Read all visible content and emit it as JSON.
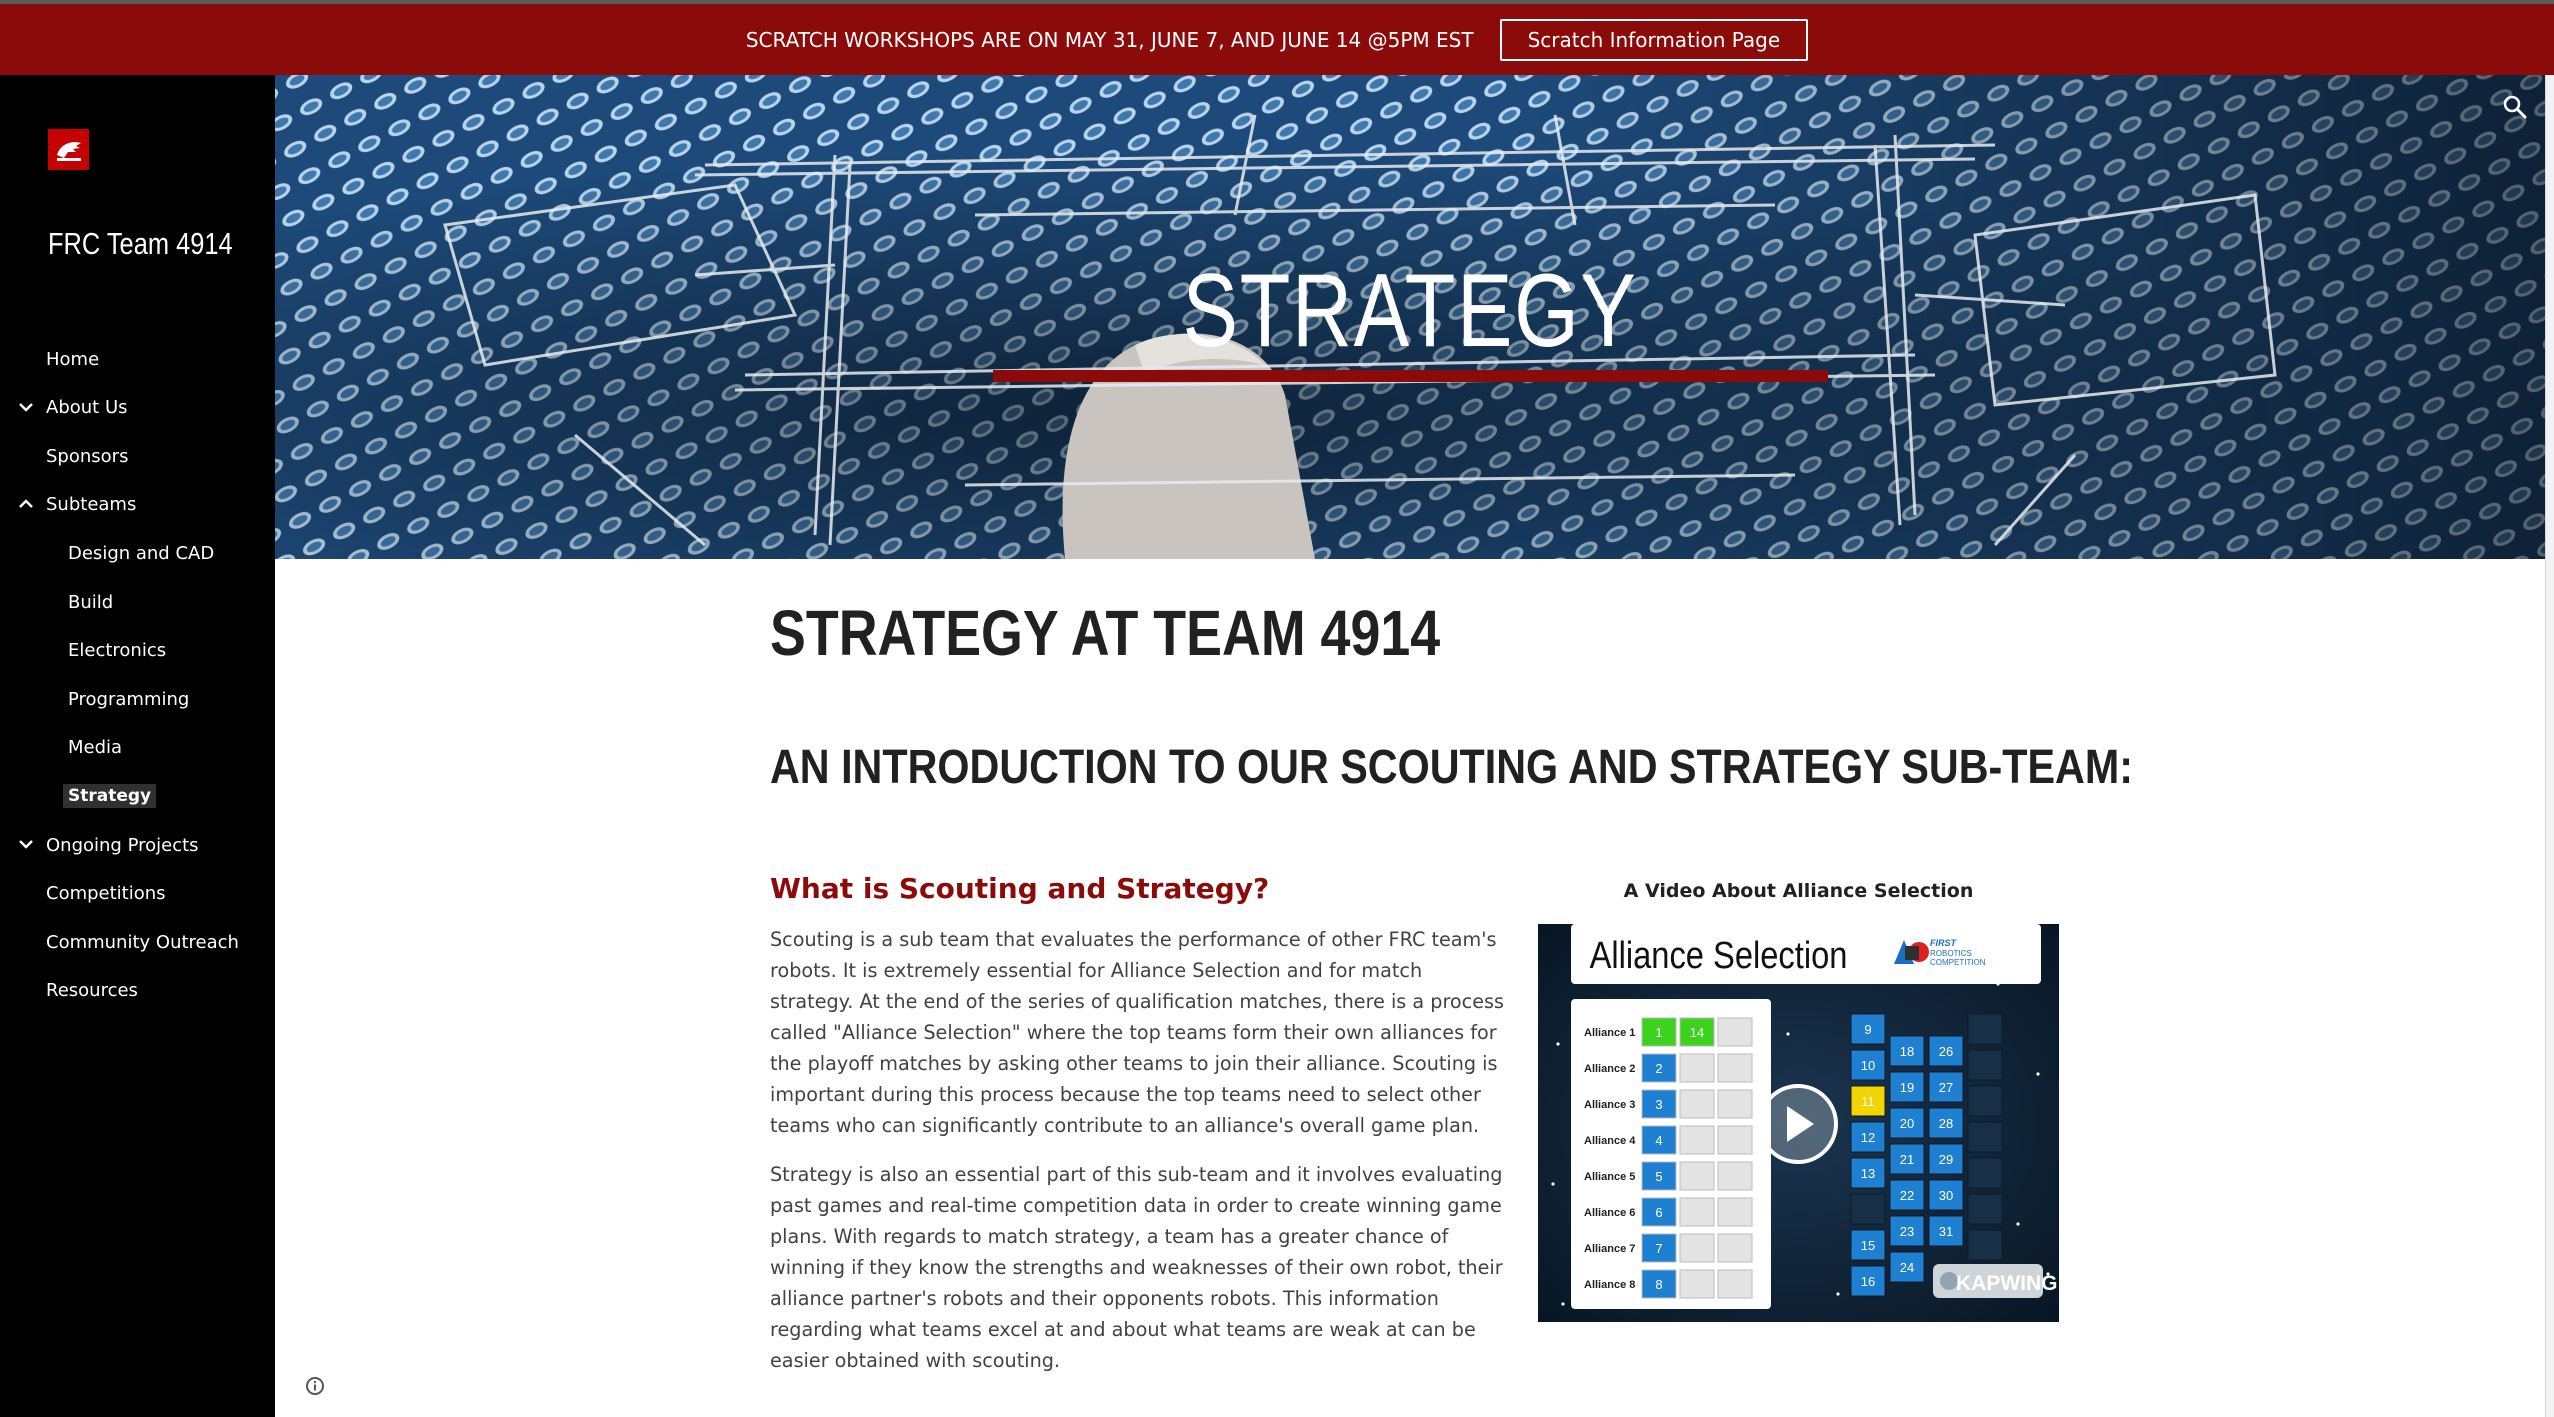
{
  "banner": {
    "text": "SCRATCH WORKSHOPS ARE ON MAY 31, JUNE 7, AND JUNE 14 @5PM EST",
    "button_label": "Scratch Information Page"
  },
  "site": {
    "title": "FRC Team 4914"
  },
  "nav": {
    "items": [
      {
        "label": "Home",
        "chevron": "none",
        "level": 0
      },
      {
        "label": "About Us",
        "chevron": "down",
        "level": 0
      },
      {
        "label": "Sponsors",
        "chevron": "none",
        "level": 0
      },
      {
        "label": "Subteams",
        "chevron": "up",
        "level": 0
      },
      {
        "label": "Design and CAD",
        "chevron": "none",
        "level": 1
      },
      {
        "label": "Build",
        "chevron": "none",
        "level": 1
      },
      {
        "label": "Electronics",
        "chevron": "none",
        "level": 1
      },
      {
        "label": "Programming",
        "chevron": "none",
        "level": 1
      },
      {
        "label": "Media",
        "chevron": "none",
        "level": 1
      },
      {
        "label": "Strategy",
        "chevron": "none",
        "level": 1,
        "active": true
      },
      {
        "label": "Ongoing Projects",
        "chevron": "down",
        "level": 0
      },
      {
        "label": "Competitions",
        "chevron": "none",
        "level": 0
      },
      {
        "label": "Community Outreach",
        "chevron": "none",
        "level": 0
      },
      {
        "label": "Resources",
        "chevron": "none",
        "level": 0
      }
    ]
  },
  "hero": {
    "title": "STRATEGY"
  },
  "content": {
    "page_heading": "STRATEGY AT TEAM 4914",
    "section_heading": "AN INTRODUCTION TO OUR SCOUTING AND STRATEGY SUB-TEAM:",
    "sub_heading": "What is Scouting and Strategy?",
    "paragraph_1": "Scouting is a sub team that evaluates the performance of other FRC team's robots. It is extremely essential for Alliance Selection and for match strategy. At the end of the series of qualification matches, there is a process called \"Alliance Selection\" where the top teams form their own alliances for the playoff matches by asking other teams to join their alliance. Scouting is important during this process because the top teams need to select other teams who can significantly contribute to an alliance's overall game plan.",
    "paragraph_2": "Strategy is also an essential part of this sub-team and it involves evaluating past games and real-time competition data in order to create winning game plans. With regards to match strategy, a team has a greater chance of winning if they know the strengths and weaknesses of their own robot, their alliance partner's robots and their opponents robots. This information regarding what teams excel at and about what teams are weak at can be easier obtained with scouting."
  },
  "video": {
    "caption": "A Video About Alliance Selection",
    "thumb_title": "Alliance Selection",
    "logo_text_1": "FIRST",
    "logo_text_2": "ROBOTICS",
    "logo_text_3": "COMPETITION",
    "watermark": "KAPWING",
    "alliances": [
      "Alliance 1",
      "Alliance 2",
      "Alliance 3",
      "Alliance 4",
      "Alliance 5",
      "Alliance 6",
      "Alliance 7",
      "Alliance 8"
    ],
    "captains": [
      "1",
      "2",
      "3",
      "4",
      "5",
      "6",
      "7",
      "8"
    ],
    "first_pick": "14",
    "pool": [
      "9",
      "10",
      "11",
      "12",
      "13",
      "15",
      "16",
      "18",
      "19",
      "20",
      "21",
      "22",
      "23",
      "24",
      "26",
      "27",
      "28",
      "29",
      "30",
      "31"
    ]
  },
  "icons": {
    "search": "search-icon",
    "info": "info-icon",
    "chevron_down": "chevron-down-icon",
    "chevron_up": "chevron-up-icon",
    "play": "play-icon"
  },
  "colors": {
    "brand_red": "#8b0b0b",
    "sidebar_bg": "#000000",
    "tile_blue": "#1f7fd0",
    "tile_green": "#3cd21e",
    "tile_yellow": "#f2d400"
  }
}
